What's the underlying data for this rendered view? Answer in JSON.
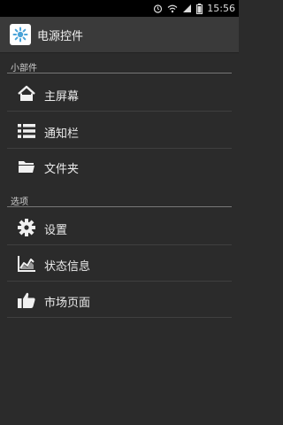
{
  "status_bar": {
    "time": "15:56"
  },
  "app": {
    "title": "电源控件"
  },
  "sections": [
    {
      "header": "小部件",
      "items": [
        {
          "label": "主屏幕",
          "icon": "home-icon"
        },
        {
          "label": "通知栏",
          "icon": "list-icon"
        },
        {
          "label": "文件夹",
          "icon": "folder-icon"
        }
      ]
    },
    {
      "header": "选项",
      "items": [
        {
          "label": "设置",
          "icon": "gear-icon"
        },
        {
          "label": "状态信息",
          "icon": "chart-icon"
        },
        {
          "label": "市场页面",
          "icon": "thumbs-up-icon"
        }
      ]
    }
  ],
  "colors": {
    "background": "#2b2b2b",
    "status_bar": "#000000",
    "action_bar": "#3a3a3a",
    "app_icon_accent": "#4aa3d8"
  }
}
